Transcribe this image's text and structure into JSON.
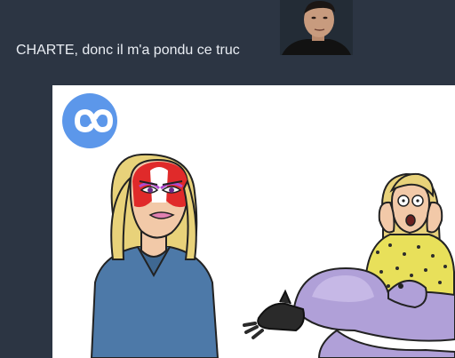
{
  "message": {
    "text": "CHARTE, donc il m'a pondu ce truc"
  },
  "avatar": {
    "icon": "user-photo-avatar"
  },
  "attachment": {
    "type": "cartoon-image",
    "app_logo_icon": "infinity-link-icon",
    "colors": {
      "page_bg": "#2c3543",
      "logo_blue": "#5c97ea",
      "hair": "#e8d27a",
      "skin": "#f2c9a8",
      "shirt": "#4d79a8",
      "face_paint_red": "#e02a2a",
      "polka_top": "#e8e05a",
      "purple_creature": "#b0a0d8"
    }
  }
}
